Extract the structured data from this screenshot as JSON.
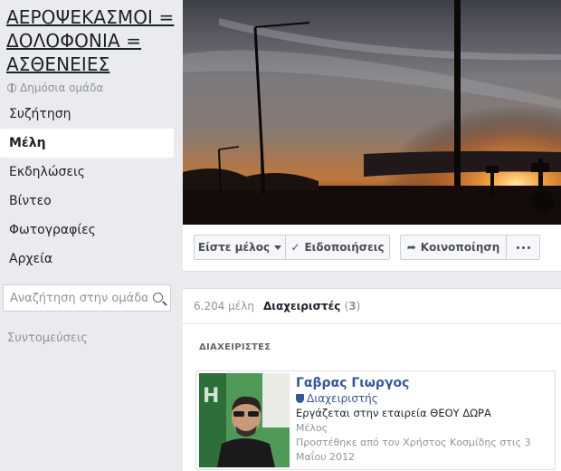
{
  "group": {
    "title": "ΑΕΡΟΨΕΚΑΣΜΟΙ = ΔΟΛΟΦΟΝΙΑ = ΑΣΘΕΝΕΙΕΣ",
    "privacy": "Δημόσια ομάδα",
    "privacy_icon": "globe-icon"
  },
  "sidebar": {
    "items": [
      {
        "label": "Συζήτηση",
        "active": false
      },
      {
        "label": "Μέλη",
        "active": true
      },
      {
        "label": "Εκδηλώσεις",
        "active": false
      },
      {
        "label": "Βίντεο",
        "active": false
      },
      {
        "label": "Φωτογραφίες",
        "active": false
      },
      {
        "label": "Αρχεία",
        "active": false
      }
    ],
    "search_placeholder": "Αναζήτηση στην ομάδα",
    "shortcuts_label": "Συντομεύσεις"
  },
  "actions": {
    "member_label": "Είστε μέλος",
    "notifications_label": "Ειδοποιήσεις",
    "share_label": "Κοινοποίηση"
  },
  "members": {
    "count_label": "6.204 μέλη",
    "admins_tab_label": "Διαχειριστές",
    "admins_count": "3",
    "section_header": "ΔΙΑΧΕΙΡΙΣΤΕΣ",
    "admins": [
      {
        "name": "Γαβρας Γιωργος",
        "role": "Διαχειριστής",
        "work": "Εργάζεται στην εταιρεία ΘΕΟΥ ΔΩΡΑ",
        "member_label": "Μέλος",
        "added": "Προστέθηκε από τον Χρήστος Κοσμίδης στις 3 Μαΐου 2012"
      }
    ]
  },
  "colors": {
    "link": "#365899",
    "background": "#e9ebee",
    "muted": "#90949c"
  }
}
